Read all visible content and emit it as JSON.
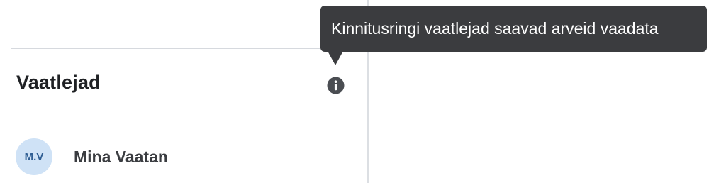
{
  "tooltip": {
    "text": "Kinnitusringi vaatlejad saavad arveid vaadata"
  },
  "section": {
    "title": "Vaatlejad",
    "info_icon": "info-icon"
  },
  "observers": [
    {
      "initials": "M.V",
      "name": "Mina Vaatan"
    }
  ],
  "colors": {
    "tooltip_bg": "#3b3c3f",
    "avatar_bg": "#cfe2f6",
    "avatar_text": "#2f5e93",
    "icon": "#4a4d52"
  }
}
